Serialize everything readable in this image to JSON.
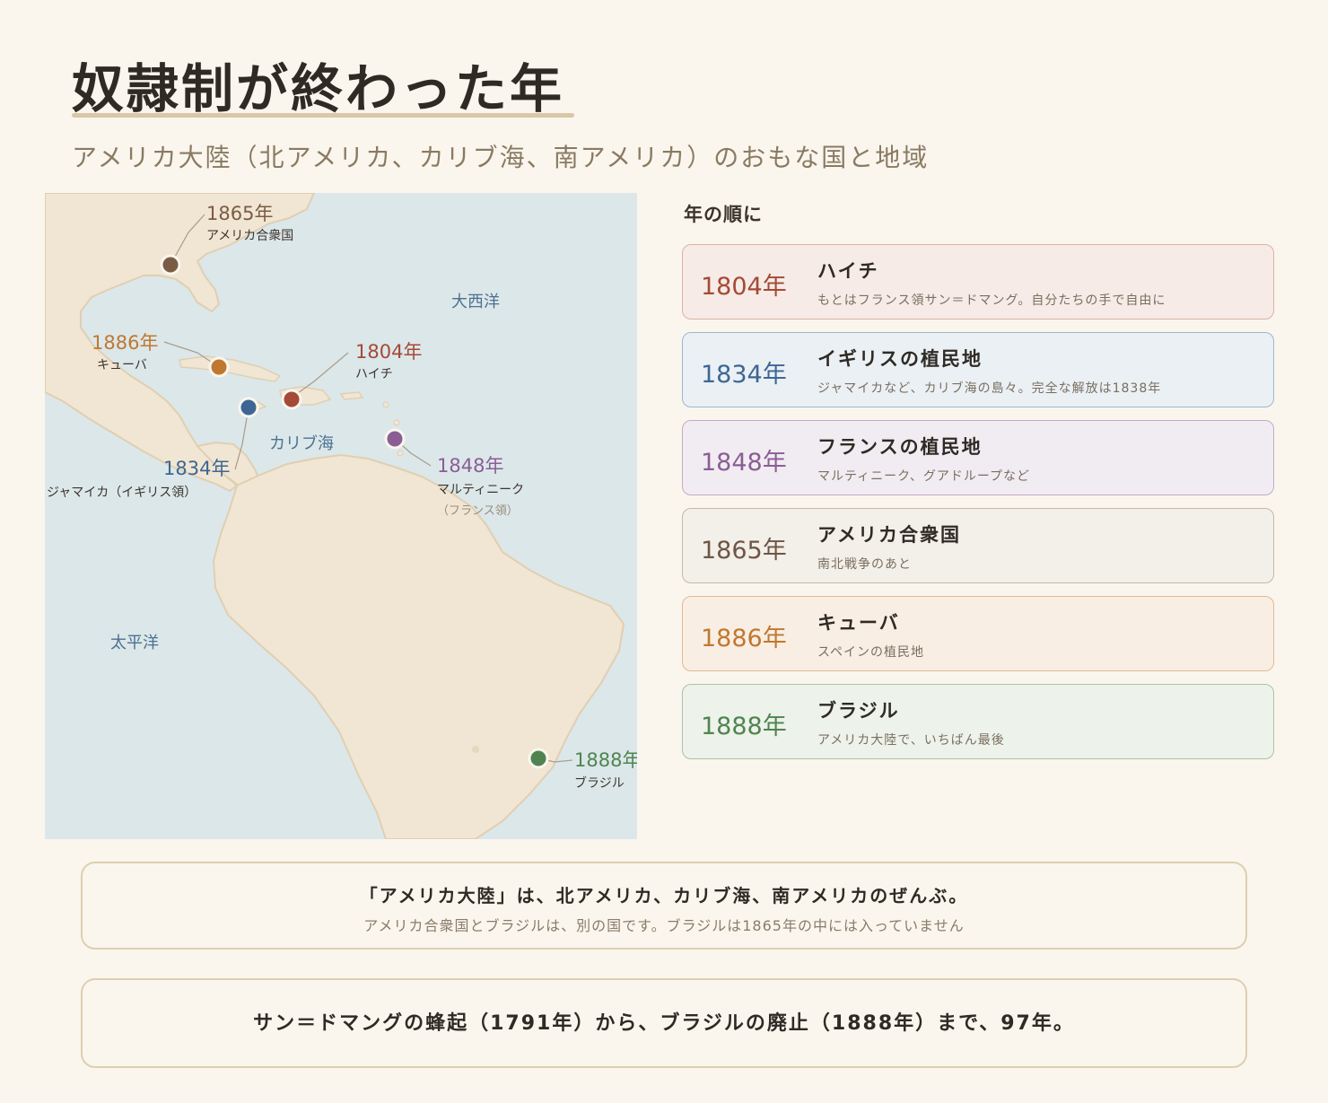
{
  "header": {
    "title": "奴隷制が終わった年",
    "subtitle": "アメリカ大陸（北アメリカ、カリブ海、南アメリカ）のおもな国と地域"
  },
  "map": {
    "ocean_labels": {
      "atlantic": "大西洋",
      "caribbean": "カリブ海",
      "pacific": "太平洋"
    },
    "markers": [
      {
        "key": "usa",
        "year": "1865年",
        "place": "アメリカ合衆国",
        "color": "#7a5c44"
      },
      {
        "key": "cuba",
        "year": "1886年",
        "place": "キューバ",
        "color": "#c07830"
      },
      {
        "key": "haiti",
        "year": "1804年",
        "place": "ハイチ",
        "color": "#a44a36"
      },
      {
        "key": "jamaica",
        "year": "1834年",
        "place": "ジャマイカ（イギリス領）",
        "color": "#3e6694"
      },
      {
        "key": "martinique",
        "year": "1848年",
        "place": "マルティニーク",
        "place2": "（フランス領）",
        "color": "#8a5e94"
      },
      {
        "key": "brazil",
        "year": "1888年",
        "place": "ブラジル",
        "color": "#4f8450"
      }
    ]
  },
  "timeline": {
    "heading": "年の順に",
    "items": [
      {
        "year": "1804年",
        "name": "ハイチ",
        "desc": "もとはフランス領サン＝ドマング。自分たちの手で自由に",
        "color": "#a44a36",
        "bg": "#f6ebe6",
        "border": "#dcb2a6"
      },
      {
        "year": "1834年",
        "name": "イギリスの植民地",
        "desc": "ジャマイカなど、カリブ海の島々。完全な解放は1838年",
        "color": "#3e6694",
        "bg": "#eaf0f4",
        "border": "#9fb6cf"
      },
      {
        "year": "1848年",
        "name": "フランスの植民地",
        "desc": "マルティニーク、グアドループなど",
        "color": "#8a5e94",
        "bg": "#f1ecf2",
        "border": "#c2abc8"
      },
      {
        "year": "1865年",
        "name": "アメリカ合衆国",
        "desc": "南北戦争のあと",
        "color": "#6e5644",
        "bg": "#f3efe9",
        "border": "#c6b8a8"
      },
      {
        "year": "1886年",
        "name": "キューバ",
        "desc": "スペインの植民地",
        "color": "#c07830",
        "bg": "#f9eee3",
        "border": "#e0bb94"
      },
      {
        "year": "1888年",
        "name": "ブラジル",
        "desc": "アメリカ大陸で、いちばん最後",
        "color": "#4f8450",
        "bg": "#edf2ea",
        "border": "#a9c4a4"
      }
    ]
  },
  "notes": {
    "note1_line1": "「アメリカ大陸」は、北アメリカ、カリブ海、南アメリカのぜんぶ。",
    "note1_line2": "アメリカ合衆国とブラジルは、別の国です。ブラジルは1865年の中には入っていません",
    "note2": "サン＝ドマングの蜂起（1791年）から、ブラジルの廃止（1888年）まで、97年。"
  }
}
